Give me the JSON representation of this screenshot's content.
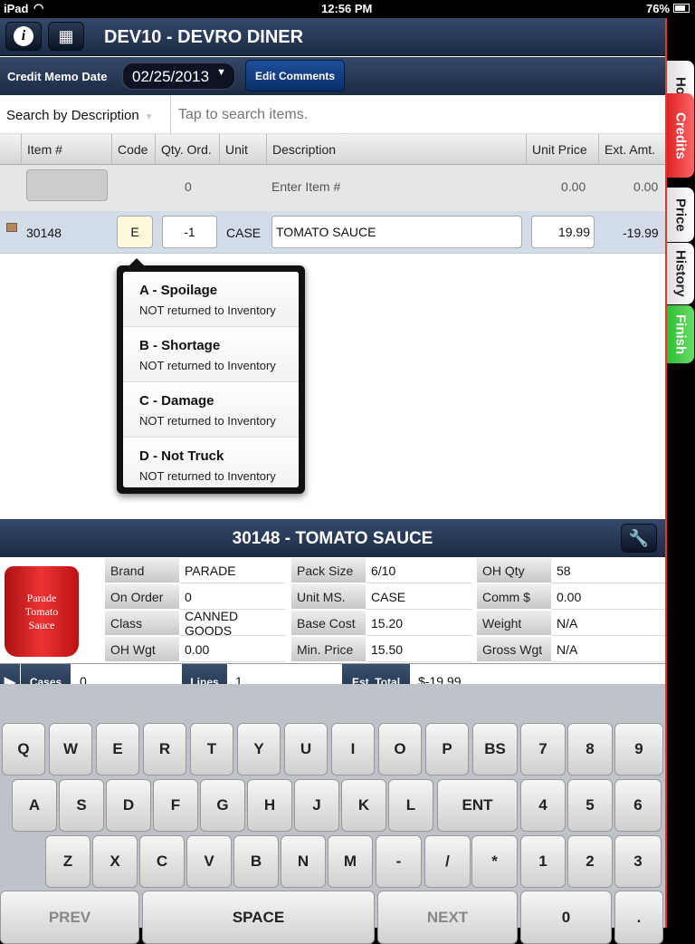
{
  "status": {
    "device": "iPad",
    "time": "12:56 PM",
    "battery": "76%"
  },
  "header": {
    "title": "DEV10 - DEVRO DINER",
    "info_icon": "info-icon",
    "calc_icon": "calculator-icon"
  },
  "toolbar": {
    "date_label": "Credit Memo Date",
    "date_value": "02/25/2013",
    "edit_comments": "Edit Comments"
  },
  "search": {
    "mode": "Search by Description",
    "placeholder": "Tap to search items."
  },
  "table": {
    "columns": [
      "Item #",
      "Code",
      "Qty. Ord.",
      "Unit",
      "Description",
      "Unit Price",
      "Ext. Amt."
    ],
    "entry_row": {
      "qty": "0",
      "description": "Enter Item #",
      "unit_price": "0.00",
      "ext_amt": "0.00"
    },
    "rows": [
      {
        "item": "30148",
        "code": "E",
        "qty": "-1",
        "unit": "CASE",
        "description": "TOMATO SAUCE",
        "unit_price": "19.99",
        "ext_amt": "-19.99"
      }
    ]
  },
  "popover": {
    "items": [
      {
        "title": "A - Spoilage",
        "subtitle": "NOT returned to Inventory"
      },
      {
        "title": "B - Shortage",
        "subtitle": "NOT returned to Inventory"
      },
      {
        "title": "C - Damage",
        "subtitle": "NOT returned to Inventory"
      },
      {
        "title": "D - Not Truck",
        "subtitle": "NOT returned to Inventory"
      }
    ]
  },
  "detail": {
    "title": "30148 - TOMATO SAUCE",
    "image_text": "Parade Tomato Sauce",
    "fields": [
      [
        [
          "Brand",
          "PARADE"
        ],
        [
          "Pack Size",
          "6/10"
        ],
        [
          "OH Qty",
          "58"
        ]
      ],
      [
        [
          "On Order",
          "0"
        ],
        [
          "Unit MS.",
          "CASE"
        ],
        [
          "Comm $",
          "0.00"
        ]
      ],
      [
        [
          "Class",
          "CANNED GOODS"
        ],
        [
          "Base Cost",
          "15.20"
        ],
        [
          "Weight",
          "N/A"
        ]
      ],
      [
        [
          "OH Wgt",
          "0.00"
        ],
        [
          "Min. Price",
          "15.50"
        ],
        [
          "Gross Wgt",
          "N/A"
        ]
      ]
    ]
  },
  "summary": {
    "cases_label": "Cases",
    "cases": "0",
    "lines_label": "Lines",
    "lines": "1",
    "total_label": "Est. Total",
    "total": "$-19.99"
  },
  "keyboard": {
    "rows": [
      [
        "Q",
        "W",
        "E",
        "R",
        "T",
        "Y",
        "U",
        "I",
        "O",
        "P",
        "BS",
        "7",
        "8",
        "9"
      ],
      [
        "A",
        "S",
        "D",
        "F",
        "G",
        "H",
        "J",
        "K",
        "L",
        "ENT",
        "4",
        "5",
        "6"
      ],
      [
        "Z",
        "X",
        "C",
        "V",
        "B",
        "N",
        "M",
        "-",
        "/",
        "*",
        "1",
        "2",
        "3"
      ],
      [
        "PREV",
        "SPACE",
        "NEXT",
        "0",
        "."
      ]
    ]
  },
  "side_tabs": [
    {
      "label": "Home"
    },
    {
      "label": "Credits",
      "active": true
    },
    {
      "label": "Price"
    },
    {
      "label": "History"
    },
    {
      "label": "Finish"
    }
  ],
  "colors": {
    "accent_red": "#e33b3b",
    "finish_green": "#4cc94c",
    "nav": "#1c2b44"
  }
}
